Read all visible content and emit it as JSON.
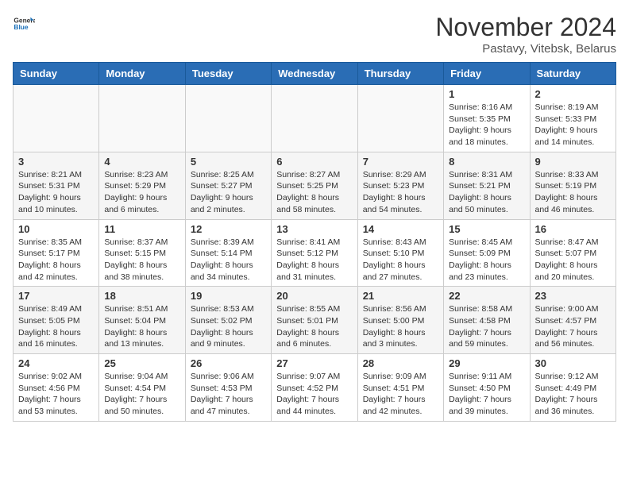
{
  "header": {
    "logo_general": "General",
    "logo_blue": "Blue",
    "month_title": "November 2024",
    "location": "Pastavy, Vitebsk, Belarus"
  },
  "days_of_week": [
    "Sunday",
    "Monday",
    "Tuesday",
    "Wednesday",
    "Thursday",
    "Friday",
    "Saturday"
  ],
  "weeks": [
    [
      {
        "day": "",
        "info": ""
      },
      {
        "day": "",
        "info": ""
      },
      {
        "day": "",
        "info": ""
      },
      {
        "day": "",
        "info": ""
      },
      {
        "day": "",
        "info": ""
      },
      {
        "day": "1",
        "info": "Sunrise: 8:16 AM\nSunset: 5:35 PM\nDaylight: 9 hours and 18 minutes."
      },
      {
        "day": "2",
        "info": "Sunrise: 8:19 AM\nSunset: 5:33 PM\nDaylight: 9 hours and 14 minutes."
      }
    ],
    [
      {
        "day": "3",
        "info": "Sunrise: 8:21 AM\nSunset: 5:31 PM\nDaylight: 9 hours and 10 minutes."
      },
      {
        "day": "4",
        "info": "Sunrise: 8:23 AM\nSunset: 5:29 PM\nDaylight: 9 hours and 6 minutes."
      },
      {
        "day": "5",
        "info": "Sunrise: 8:25 AM\nSunset: 5:27 PM\nDaylight: 9 hours and 2 minutes."
      },
      {
        "day": "6",
        "info": "Sunrise: 8:27 AM\nSunset: 5:25 PM\nDaylight: 8 hours and 58 minutes."
      },
      {
        "day": "7",
        "info": "Sunrise: 8:29 AM\nSunset: 5:23 PM\nDaylight: 8 hours and 54 minutes."
      },
      {
        "day": "8",
        "info": "Sunrise: 8:31 AM\nSunset: 5:21 PM\nDaylight: 8 hours and 50 minutes."
      },
      {
        "day": "9",
        "info": "Sunrise: 8:33 AM\nSunset: 5:19 PM\nDaylight: 8 hours and 46 minutes."
      }
    ],
    [
      {
        "day": "10",
        "info": "Sunrise: 8:35 AM\nSunset: 5:17 PM\nDaylight: 8 hours and 42 minutes."
      },
      {
        "day": "11",
        "info": "Sunrise: 8:37 AM\nSunset: 5:15 PM\nDaylight: 8 hours and 38 minutes."
      },
      {
        "day": "12",
        "info": "Sunrise: 8:39 AM\nSunset: 5:14 PM\nDaylight: 8 hours and 34 minutes."
      },
      {
        "day": "13",
        "info": "Sunrise: 8:41 AM\nSunset: 5:12 PM\nDaylight: 8 hours and 31 minutes."
      },
      {
        "day": "14",
        "info": "Sunrise: 8:43 AM\nSunset: 5:10 PM\nDaylight: 8 hours and 27 minutes."
      },
      {
        "day": "15",
        "info": "Sunrise: 8:45 AM\nSunset: 5:09 PM\nDaylight: 8 hours and 23 minutes."
      },
      {
        "day": "16",
        "info": "Sunrise: 8:47 AM\nSunset: 5:07 PM\nDaylight: 8 hours and 20 minutes."
      }
    ],
    [
      {
        "day": "17",
        "info": "Sunrise: 8:49 AM\nSunset: 5:05 PM\nDaylight: 8 hours and 16 minutes."
      },
      {
        "day": "18",
        "info": "Sunrise: 8:51 AM\nSunset: 5:04 PM\nDaylight: 8 hours and 13 minutes."
      },
      {
        "day": "19",
        "info": "Sunrise: 8:53 AM\nSunset: 5:02 PM\nDaylight: 8 hours and 9 minutes."
      },
      {
        "day": "20",
        "info": "Sunrise: 8:55 AM\nSunset: 5:01 PM\nDaylight: 8 hours and 6 minutes."
      },
      {
        "day": "21",
        "info": "Sunrise: 8:56 AM\nSunset: 5:00 PM\nDaylight: 8 hours and 3 minutes."
      },
      {
        "day": "22",
        "info": "Sunrise: 8:58 AM\nSunset: 4:58 PM\nDaylight: 7 hours and 59 minutes."
      },
      {
        "day": "23",
        "info": "Sunrise: 9:00 AM\nSunset: 4:57 PM\nDaylight: 7 hours and 56 minutes."
      }
    ],
    [
      {
        "day": "24",
        "info": "Sunrise: 9:02 AM\nSunset: 4:56 PM\nDaylight: 7 hours and 53 minutes."
      },
      {
        "day": "25",
        "info": "Sunrise: 9:04 AM\nSunset: 4:54 PM\nDaylight: 7 hours and 50 minutes."
      },
      {
        "day": "26",
        "info": "Sunrise: 9:06 AM\nSunset: 4:53 PM\nDaylight: 7 hours and 47 minutes."
      },
      {
        "day": "27",
        "info": "Sunrise: 9:07 AM\nSunset: 4:52 PM\nDaylight: 7 hours and 44 minutes."
      },
      {
        "day": "28",
        "info": "Sunrise: 9:09 AM\nSunset: 4:51 PM\nDaylight: 7 hours and 42 minutes."
      },
      {
        "day": "29",
        "info": "Sunrise: 9:11 AM\nSunset: 4:50 PM\nDaylight: 7 hours and 39 minutes."
      },
      {
        "day": "30",
        "info": "Sunrise: 9:12 AM\nSunset: 4:49 PM\nDaylight: 7 hours and 36 minutes."
      }
    ]
  ]
}
